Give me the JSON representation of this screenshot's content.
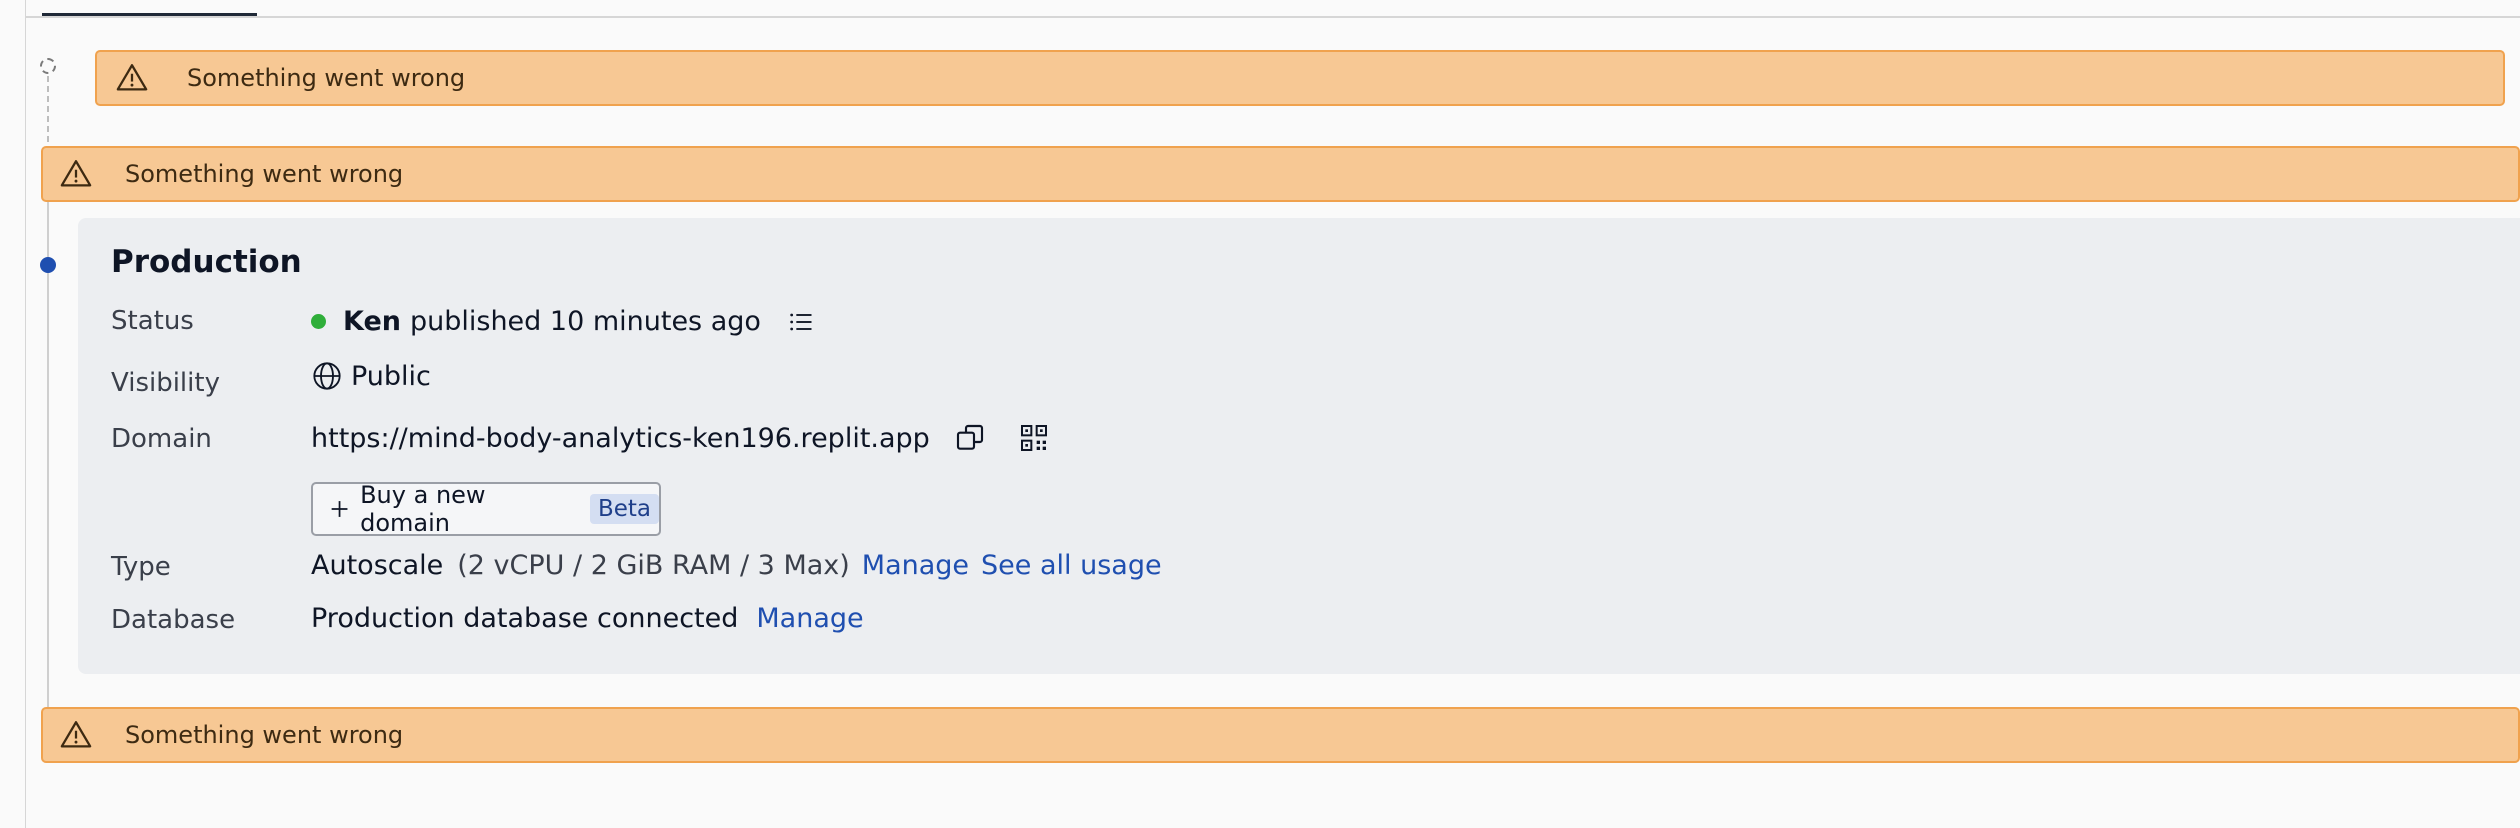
{
  "alerts": [
    {
      "message": "Something went wrong"
    },
    {
      "message": "Something went wrong"
    },
    {
      "message": "Something went wrong"
    }
  ],
  "production": {
    "title": "Production",
    "status": {
      "label": "Status",
      "user": "Ken",
      "text": "published 10 minutes ago",
      "indicator_color": "#2fae3a"
    },
    "visibility": {
      "label": "Visibility",
      "value": "Public"
    },
    "domain": {
      "label": "Domain",
      "url": "https://mind-body-analytics-ken196.replit.app"
    },
    "buy_domain": {
      "label": "Buy a new domain",
      "badge": "Beta"
    },
    "type": {
      "label": "Type",
      "value": "Autoscale",
      "spec": "(2 vCPU / 2 GiB RAM / 3 Max)",
      "manage_link": "Manage",
      "usage_link": "See all usage"
    },
    "database": {
      "label": "Database",
      "value": "Production database connected",
      "manage_link": "Manage"
    }
  },
  "colors": {
    "accent": "#1f4fb0",
    "alert_bg": "#f7c894",
    "alert_border": "#f0a24e",
    "card_bg": "#eceef1"
  },
  "icons": [
    "warning-icon",
    "list-icon",
    "globe-icon",
    "copy-icon",
    "qr-code-icon",
    "plus-icon"
  ]
}
